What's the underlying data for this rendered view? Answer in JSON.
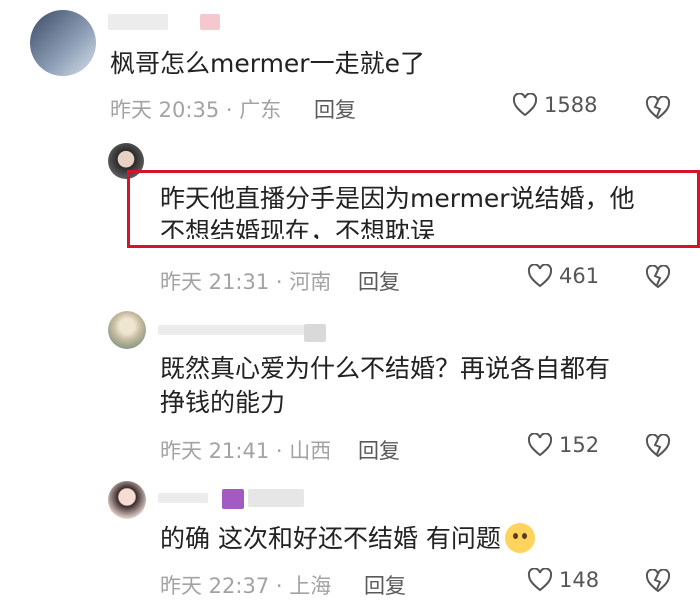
{
  "comments": [
    {
      "text_lines": [
        "枫哥怎么mermer一走就e了"
      ],
      "meta": "昨天 20:35 · 广东",
      "reply": "回复",
      "likes": "1588"
    },
    {
      "text_lines": [
        "昨天他直播分手是因为mermer说结婚，他",
        "不想结婚现在，不想耽误"
      ],
      "meta": "昨天 21:31 · 河南",
      "reply": "回复",
      "likes": "461"
    },
    {
      "text_lines": [
        "既然真心爱为什么不结婚？再说各自都有",
        "挣钱的能力"
      ],
      "meta": "昨天 21:41 · 山西",
      "reply": "回复",
      "likes": "152"
    },
    {
      "text_lines": [
        "的确 这次和好还不结婚 有问题"
      ],
      "meta": "昨天 22:37 · 上海",
      "reply": "回复",
      "likes": "148"
    }
  ],
  "icons": {
    "like": "heart-outline-icon",
    "dislike": "broken-heart-icon",
    "emoji": "pleading-face-emoji"
  },
  "colors": {
    "highlight_border": "#d4142b",
    "meta_gray": "#a3a3a3",
    "text": "#222222"
  }
}
